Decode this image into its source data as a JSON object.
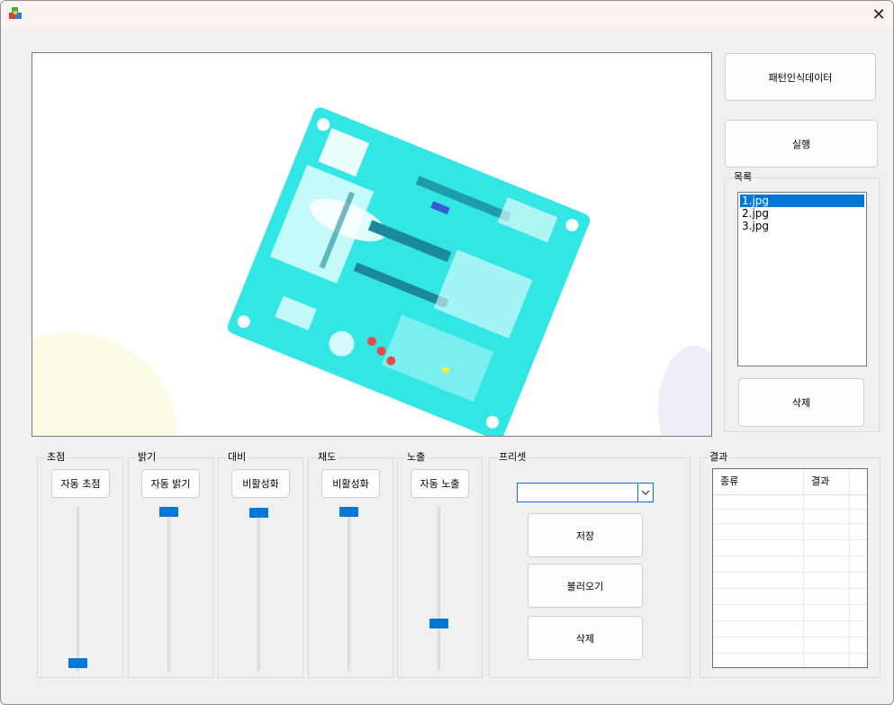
{
  "window": {
    "title": "",
    "close_glyph": "✕"
  },
  "buttons": {
    "pattern_data": "패턴인식데이터",
    "run": "실행",
    "list_delete": "삭제",
    "preset_save": "저장",
    "preset_load": "불러오기",
    "preset_delete": "삭제"
  },
  "list": {
    "label": "목록",
    "items": [
      "1.jpg",
      "2.jpg",
      "3.jpg"
    ],
    "selected": "1.jpg"
  },
  "controls": {
    "focus": {
      "label": "초점",
      "button": "자동 초점",
      "level": 0.0
    },
    "brightness": {
      "label": "밝기",
      "button": "자동 밝기",
      "level": 1.0
    },
    "contrast": {
      "label": "대비",
      "button": "비활성화",
      "level": 1.0
    },
    "saturation": {
      "label": "채도",
      "button": "비활성화",
      "level": 1.0
    },
    "exposure": {
      "label": "노출",
      "button": "자동 노출",
      "level": 0.3
    }
  },
  "preset": {
    "label": "프리셋",
    "value": ""
  },
  "result": {
    "label": "결과",
    "columns": [
      "종류",
      "결과"
    ]
  },
  "colors": {
    "accent": "#0078d7",
    "pcb": "#33e6e6"
  }
}
